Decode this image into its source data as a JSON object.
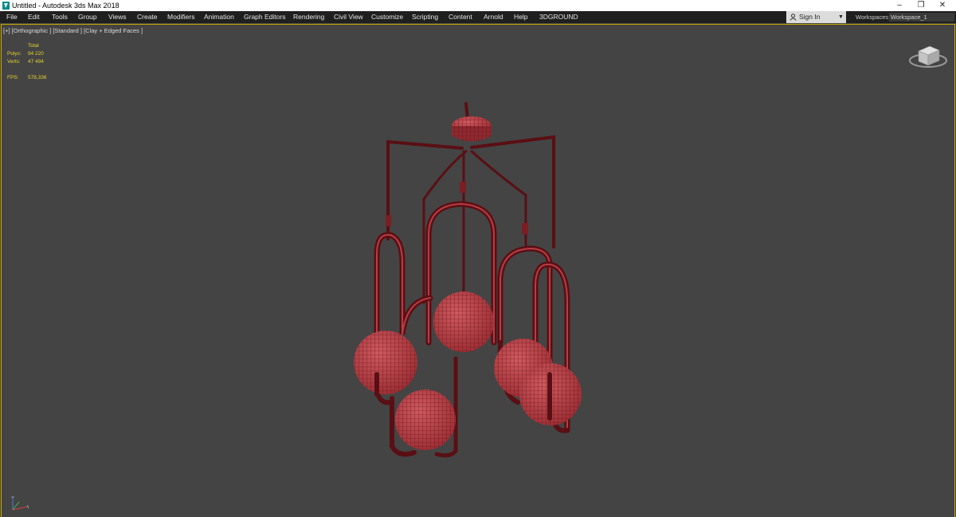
{
  "window": {
    "title": "Untitled - Autodesk 3ds Max 2018",
    "minimize_glyph": "–",
    "maximize_glyph": "❐",
    "close_glyph": "✕"
  },
  "menu": {
    "items": [
      "File",
      "Edit",
      "Tools",
      "Group",
      "Views",
      "Create",
      "Modifiers",
      "Animation",
      "Graph Editors",
      "Rendering",
      "Civil View",
      "Customize",
      "Scripting",
      "Content",
      "Arnold",
      "Help",
      "3DGROUND"
    ]
  },
  "account": {
    "sign_in": "Sign In",
    "dropdown_glyph": "▼"
  },
  "workspaces": {
    "label": "Workspaces:",
    "value": "Workspace_1"
  },
  "viewport": {
    "label": "[+] [Orthographic ] [Standard ] [Clay + Edged Faces ]",
    "stats": {
      "header": "Total",
      "polys_label": "Polys:",
      "polys_value": "94 220",
      "verts_label": "Verts:",
      "verts_value": "47 494",
      "fps_label": "FPS:",
      "fps_value": "578,336"
    }
  },
  "colors": {
    "viewport_bg": "#444444",
    "model_fill": "#c0444a",
    "model_wire": "#5a0f14",
    "stats_text": "#e8d32c",
    "active_frame": "#c9a800"
  },
  "icons": [
    "3dsmax-app-icon",
    "user-icon",
    "viewcube-icon",
    "axis-tripod-icon"
  ]
}
